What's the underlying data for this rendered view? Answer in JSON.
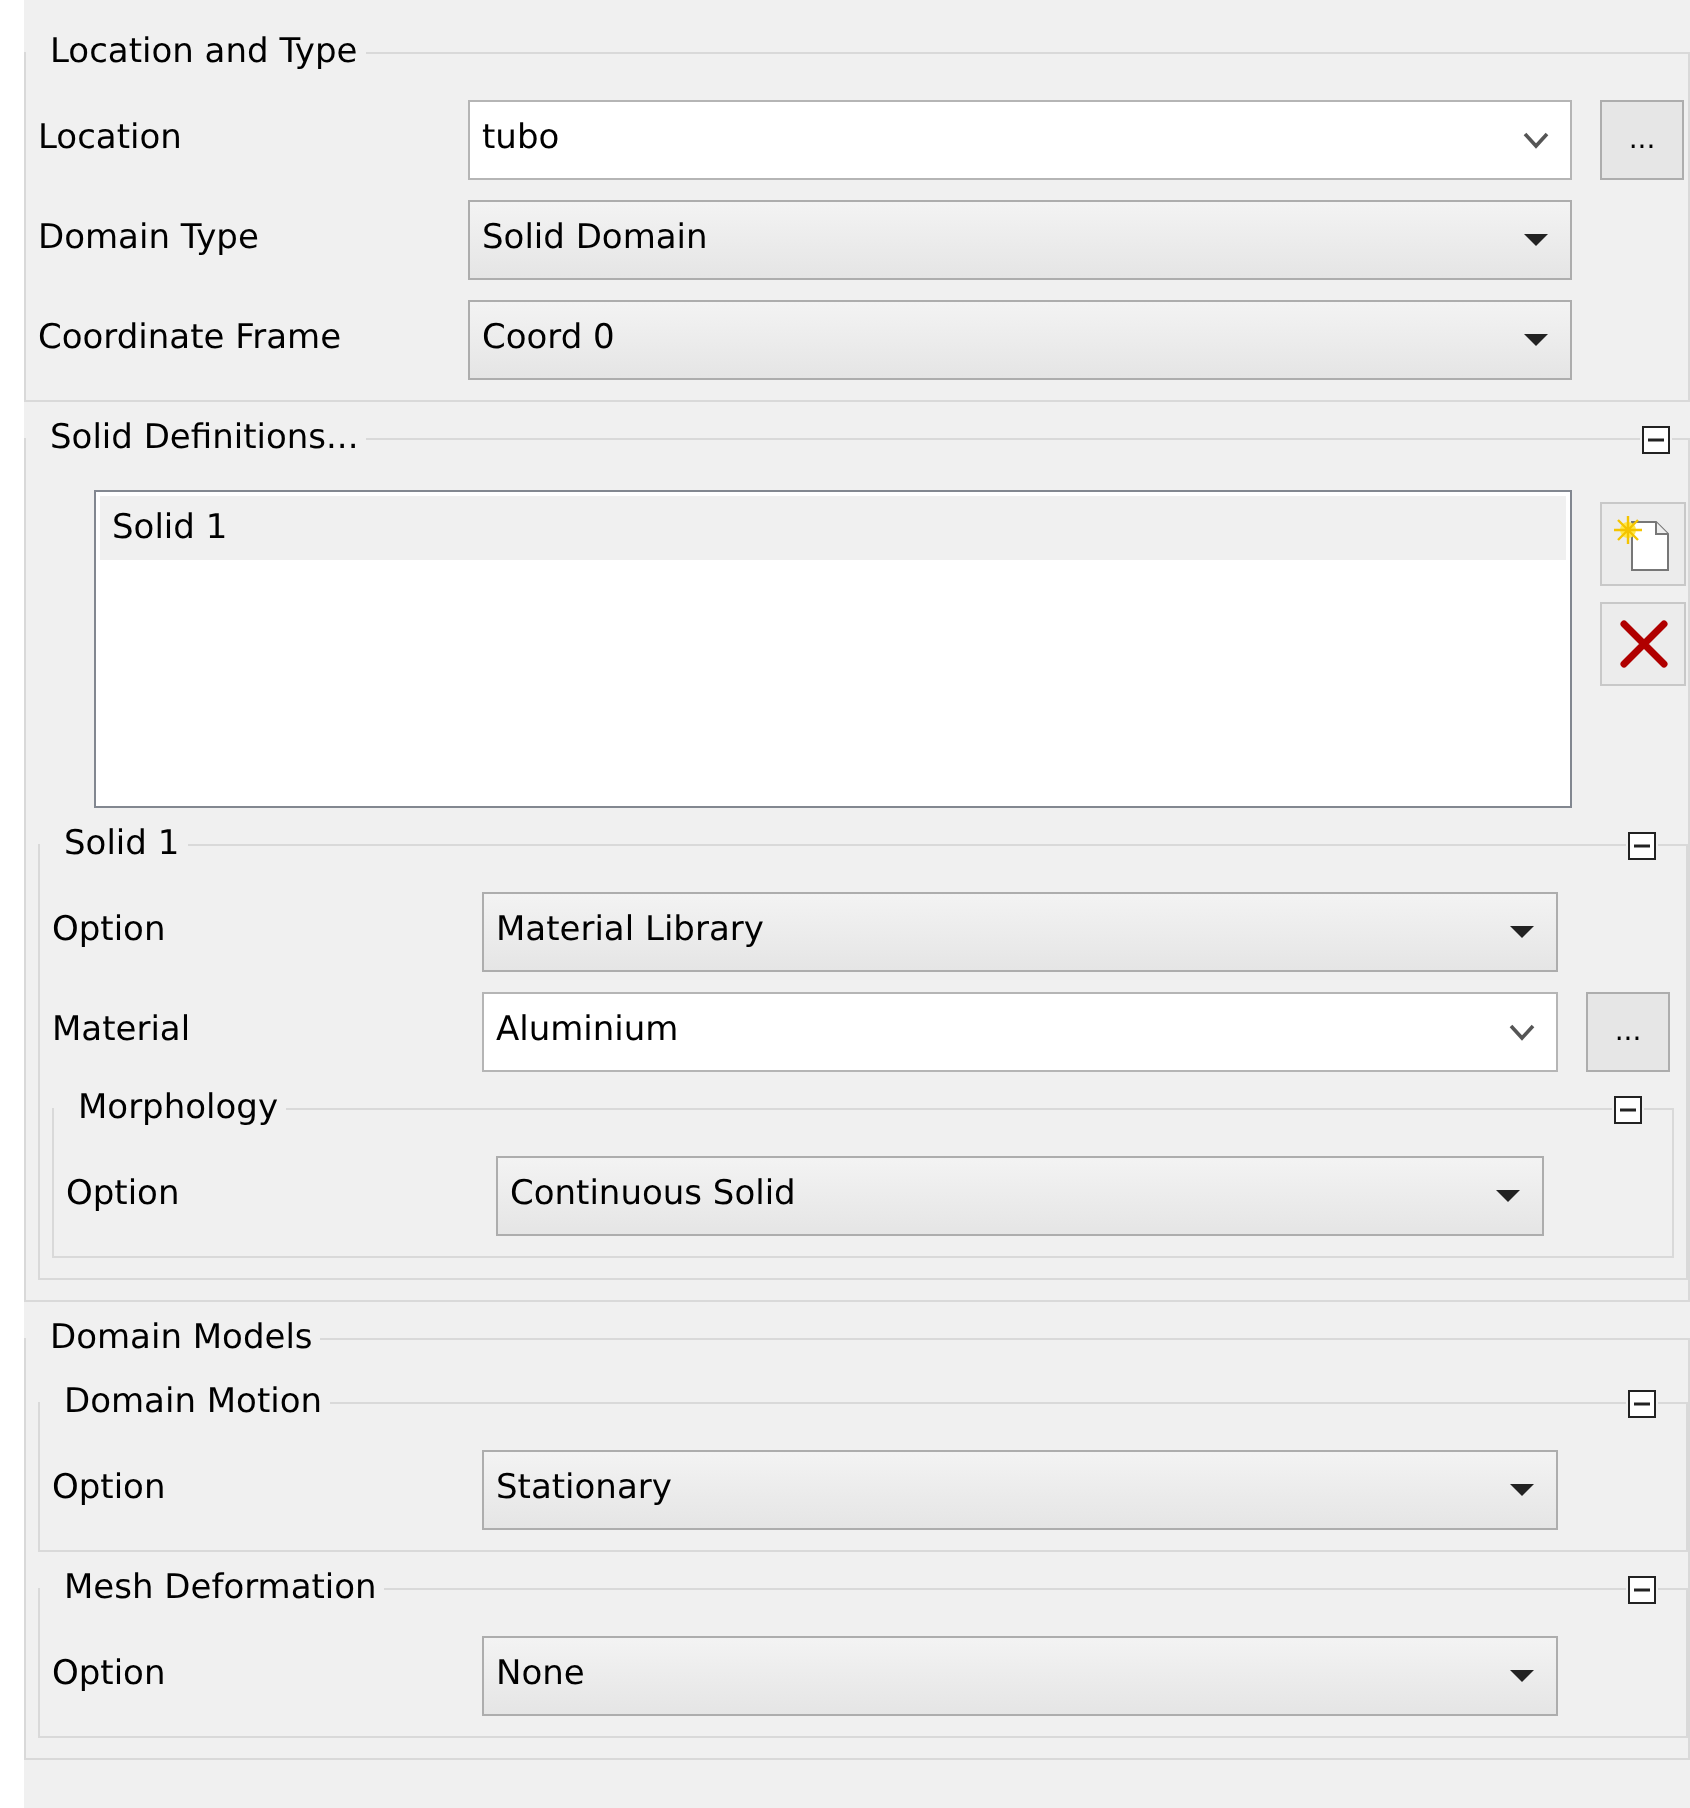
{
  "groups": [
    {
      "title": "Location and Type",
      "items": [
        {
          "kind": "combo",
          "label": "Location",
          "value": "tubo",
          "browse": "..."
        },
        {
          "kind": "dropdown",
          "label": "Domain Type",
          "value": "Solid Domain"
        },
        {
          "kind": "dropdown",
          "label": "Coordinate Frame",
          "value": "Coord 0"
        }
      ]
    },
    {
      "title": "Solid Definitions...",
      "expanded": true,
      "items": [
        {
          "kind": "list",
          "entries": [
            {
              "label": "Solid 1",
              "selected": true
            }
          ]
        },
        {
          "kind": "group",
          "title": "Solid 1",
          "expanded": true,
          "items": [
            {
              "kind": "dropdown",
              "label": "Option",
              "value": "Material Library"
            },
            {
              "kind": "combo",
              "label": "Material",
              "value": "Aluminium",
              "browse": "..."
            },
            {
              "kind": "group",
              "title": "Morphology",
              "expanded": true,
              "items": [
                {
                  "kind": "dropdown",
                  "label": "Option",
                  "value": "Continuous Solid"
                }
              ]
            }
          ]
        }
      ]
    },
    {
      "title": "Domain Models",
      "items": [
        {
          "kind": "group",
          "title": "Domain Motion",
          "expanded": true,
          "items": [
            {
              "kind": "dropdown",
              "label": "Option",
              "value": "Stationary"
            }
          ]
        },
        {
          "kind": "group",
          "title": "Mesh Deformation",
          "expanded": true,
          "items": [
            {
              "kind": "dropdown",
              "label": "Option",
              "value": "None"
            }
          ]
        }
      ]
    }
  ]
}
